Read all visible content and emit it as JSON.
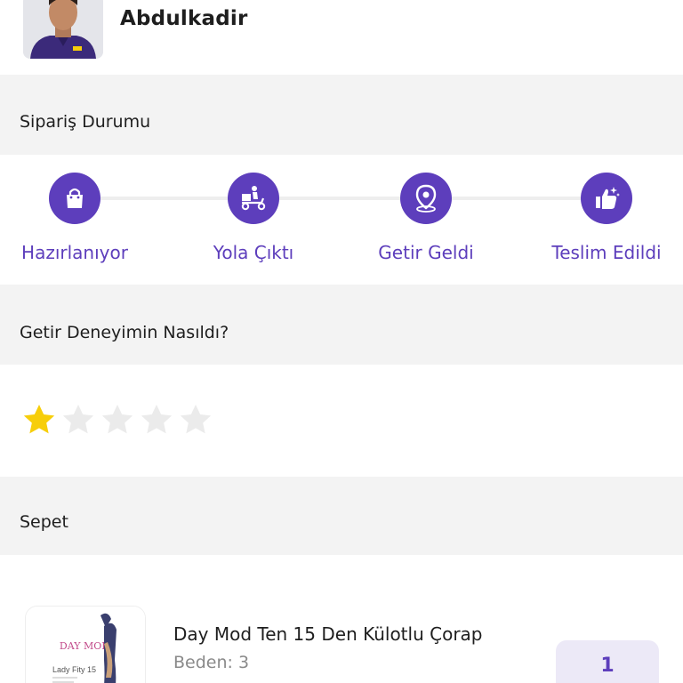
{
  "courier": {
    "name": "Abdulkadir",
    "avatar_icon": "courier-avatar"
  },
  "order_status": {
    "title": "Sipariş Durumu",
    "steps": [
      {
        "label": "Hazırlanıyor",
        "icon": "shopping-bag-icon"
      },
      {
        "label": "Yola Çıktı",
        "icon": "delivery-scooter-icon"
      },
      {
        "label": "Getir Geldi",
        "icon": "location-pin-icon"
      },
      {
        "label": "Teslim Edildi",
        "icon": "thumbs-up-icon"
      }
    ],
    "accent_color": "#5d3ebc"
  },
  "experience": {
    "title": "Getir Deneyimin Nasıldı?",
    "rating": 1,
    "max_rating": 5,
    "active_star_color": "#f7ce0a",
    "inactive_star_color": "#ebebeb"
  },
  "basket": {
    "title": "Sepet",
    "items": [
      {
        "name": "Day Mod Ten 15 Den Külotlu Çorap",
        "size": "Beden: 3",
        "quantity": "1",
        "image_brand": "DAY MOD",
        "image_caption": "Lady Fity 15"
      }
    ]
  }
}
